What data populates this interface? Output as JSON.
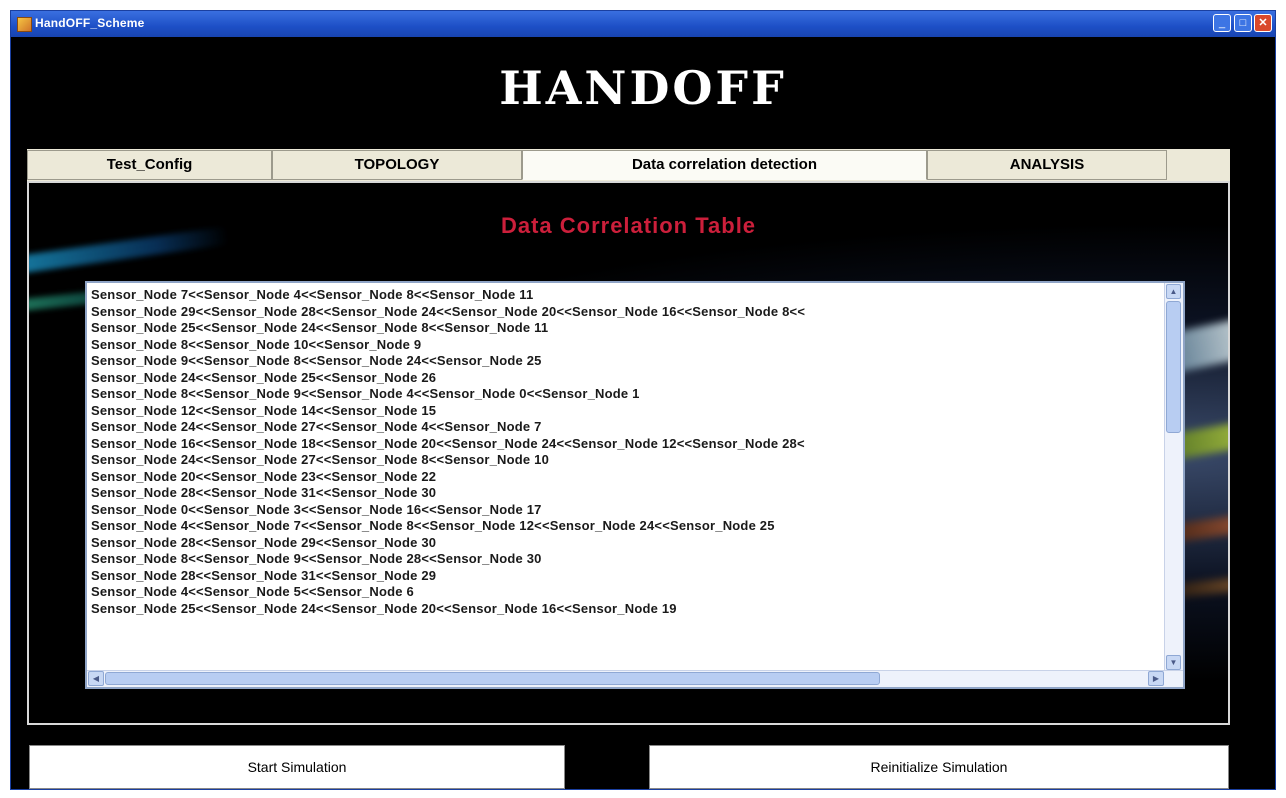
{
  "window": {
    "title": "HandOFF_Scheme",
    "controls": {
      "minimize": "_",
      "maximize": "□",
      "close": "✕"
    }
  },
  "banner": {
    "heading": "HANDOFF"
  },
  "tabs": [
    {
      "label": "Test_Config",
      "active": false
    },
    {
      "label": "TOPOLOGY",
      "active": false
    },
    {
      "label": "Data correlation detection",
      "active": true
    },
    {
      "label": "ANALYSIS",
      "active": false
    }
  ],
  "panel": {
    "title": "Data Correlation Table",
    "lines": [
      "Sensor_Node 7<<Sensor_Node 4<<Sensor_Node 8<<Sensor_Node 11",
      "Sensor_Node 29<<Sensor_Node 28<<Sensor_Node 24<<Sensor_Node 20<<Sensor_Node 16<<Sensor_Node 8<<",
      "Sensor_Node 25<<Sensor_Node 24<<Sensor_Node 8<<Sensor_Node 11",
      "Sensor_Node 8<<Sensor_Node 10<<Sensor_Node 9",
      "Sensor_Node 9<<Sensor_Node 8<<Sensor_Node 24<<Sensor_Node 25",
      "Sensor_Node 24<<Sensor_Node 25<<Sensor_Node 26",
      "Sensor_Node 8<<Sensor_Node 9<<Sensor_Node 4<<Sensor_Node 0<<Sensor_Node 1",
      "Sensor_Node 12<<Sensor_Node 14<<Sensor_Node 15",
      "Sensor_Node 24<<Sensor_Node 27<<Sensor_Node 4<<Sensor_Node 7",
      "Sensor_Node 16<<Sensor_Node 18<<Sensor_Node 20<<Sensor_Node 24<<Sensor_Node 12<<Sensor_Node 28<",
      "Sensor_Node 24<<Sensor_Node 27<<Sensor_Node 8<<Sensor_Node 10",
      "Sensor_Node 20<<Sensor_Node 23<<Sensor_Node 22",
      "Sensor_Node 28<<Sensor_Node 31<<Sensor_Node 30",
      "Sensor_Node 0<<Sensor_Node 3<<Sensor_Node 16<<Sensor_Node 17",
      "Sensor_Node 4<<Sensor_Node 7<<Sensor_Node 8<<Sensor_Node 12<<Sensor_Node 24<<Sensor_Node 25",
      "Sensor_Node 28<<Sensor_Node 29<<Sensor_Node 30",
      "Sensor_Node 8<<Sensor_Node 9<<Sensor_Node 28<<Sensor_Node 30",
      "Sensor_Node 28<<Sensor_Node 31<<Sensor_Node 29",
      "Sensor_Node 4<<Sensor_Node 5<<Sensor_Node 6",
      "Sensor_Node 25<<Sensor_Node 24<<Sensor_Node 20<<Sensor_Node 16<<Sensor_Node 19"
    ]
  },
  "buttons": {
    "start": "Start Simulation",
    "reinit": "Reinitialize Simulation"
  },
  "icons": {
    "scroll_up": "▲",
    "scroll_down": "▼",
    "scroll_left": "◀",
    "scroll_right": "▶"
  },
  "colors": {
    "title_bar": "#1d4fc6",
    "table_title": "#cc1f3b",
    "tab_bg": "#ece9d8"
  }
}
